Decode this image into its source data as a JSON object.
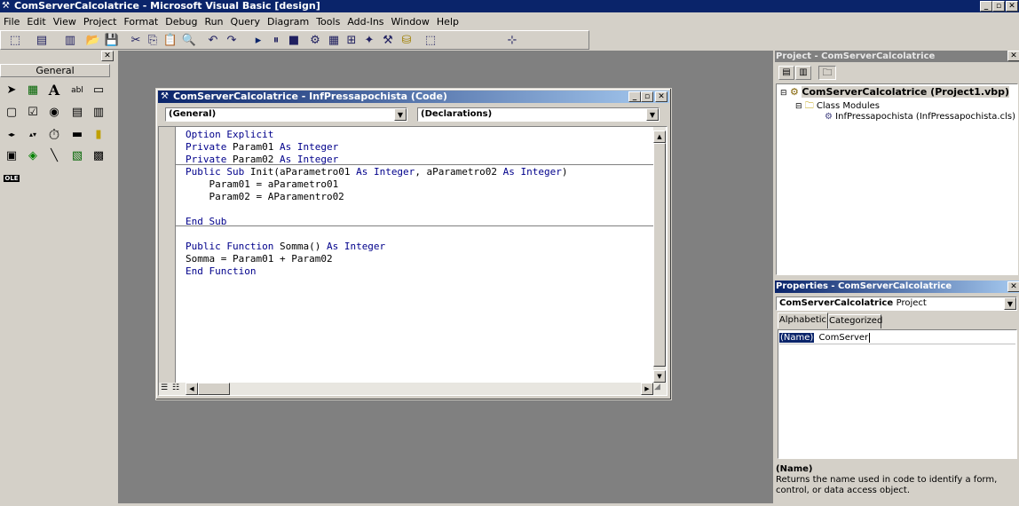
{
  "app": {
    "title": "ComServerCalcolatrice - Microsoft Visual Basic [design]",
    "caption_buttons": [
      "_",
      "▫",
      "✕"
    ]
  },
  "menu": [
    "File",
    "Edit",
    "View",
    "Project",
    "Format",
    "Debug",
    "Run",
    "Query",
    "Diagram",
    "Tools",
    "Add-Ins",
    "Window",
    "Help"
  ],
  "toolbox": {
    "header": "General",
    "close": "✕",
    "tools": [
      "➤",
      "▦",
      "A",
      "abl",
      "▭",
      "▢",
      "☑",
      "◉",
      "▤",
      "▥",
      "◂▸",
      "▴▾",
      "⏱",
      "▬",
      "▮",
      "▣",
      "◈",
      "╲",
      "▧",
      "▩",
      "OLE"
    ]
  },
  "code_window": {
    "title": "ComServerCalcolatrice - InfPressapochista (Code)",
    "object_combo": "(General)",
    "proc_combo": "(Declarations)",
    "lines": [
      [
        {
          "t": "Option Explicit",
          "k": true
        }
      ],
      [
        {
          "t": "Private ",
          "k": true
        },
        {
          "t": "Param01 ",
          "k": false
        },
        {
          "t": "As Integer",
          "k": true
        }
      ],
      [
        {
          "t": "Private ",
          "k": true
        },
        {
          "t": "Param02 ",
          "k": false
        },
        {
          "t": "As Integer",
          "k": true
        }
      ],
      [
        {
          "t": "Public Sub ",
          "k": true
        },
        {
          "t": "Init(aParametro01 ",
          "k": false
        },
        {
          "t": "As Integer",
          "k": true
        },
        {
          "t": ", aParametro02 ",
          "k": false
        },
        {
          "t": "As Integer",
          "k": true
        },
        {
          "t": ")",
          "k": false
        }
      ],
      [
        {
          "t": "    Param01 = aParametro01",
          "k": false
        }
      ],
      [
        {
          "t": "    Param02 = AParamentro02",
          "k": false
        }
      ],
      [
        {
          "t": "",
          "k": false
        }
      ],
      [
        {
          "t": "End Sub",
          "k": true
        }
      ],
      [
        {
          "t": "",
          "k": false
        }
      ],
      [
        {
          "t": "Public Function ",
          "k": true
        },
        {
          "t": "Somma() ",
          "k": false
        },
        {
          "t": "As Integer",
          "k": true
        }
      ],
      [
        {
          "t": "Somma = Param01 + Param02",
          "k": false
        }
      ],
      [
        {
          "t": "End Function",
          "k": true
        }
      ]
    ]
  },
  "project": {
    "title": "Project - ComServerCalcolatrice",
    "root": "ComServerCalcolatrice (Project1.vbp)",
    "folder": "Class Modules",
    "module": "InfPressapochista (InfPressapochista.cls)"
  },
  "properties": {
    "title": "Properties - ComServerCalcolatrice",
    "object_bold": "ComServerCalcolatrice",
    "object_type": "Project",
    "tab_alpha": "Alphabetic",
    "tab_cat": "Categorized",
    "prop_name": "(Name)",
    "prop_value": "ComServer",
    "desc_title": "(Name)",
    "desc_text": "Returns the name used in code to identify a form, control, or data access object."
  }
}
